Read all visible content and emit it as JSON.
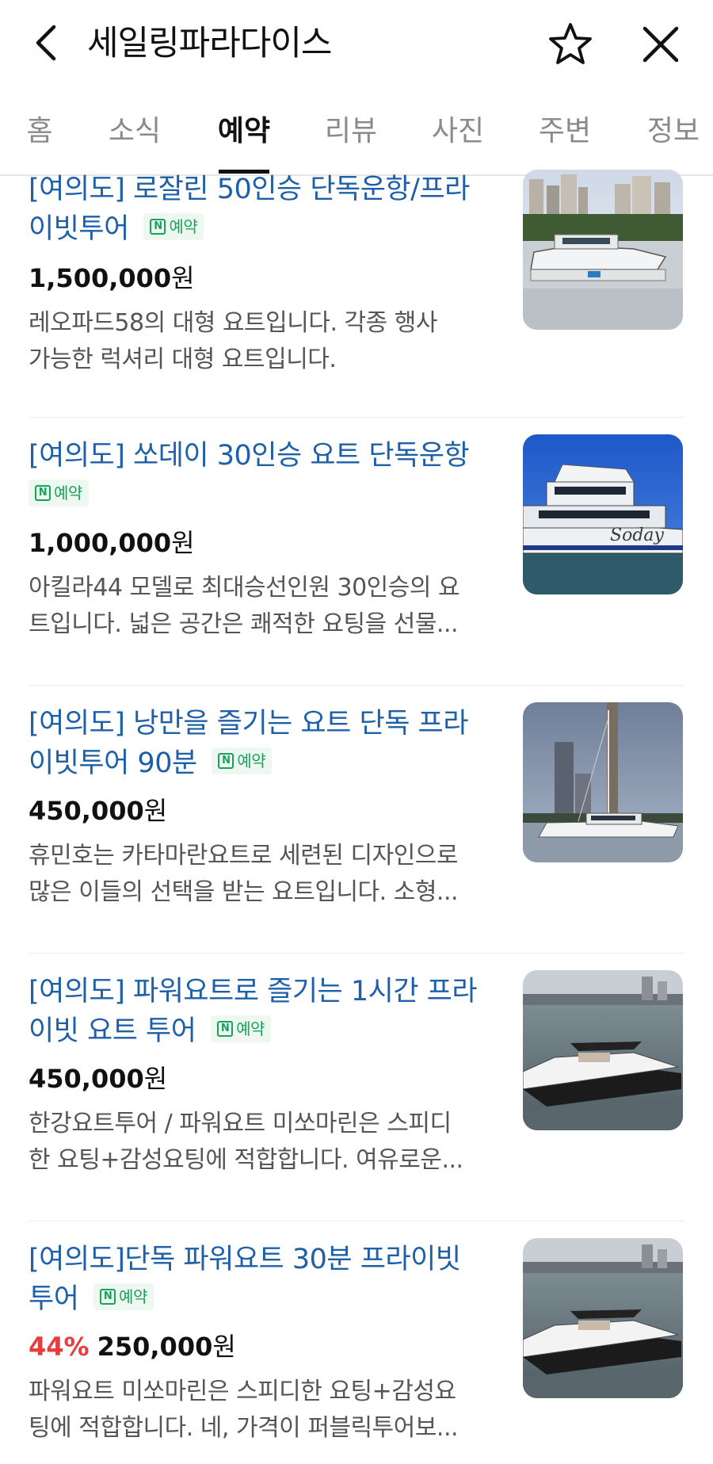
{
  "header": {
    "title": "세일링파라다이스",
    "back_icon": "chevron-left-icon",
    "star_icon": "star-outline-icon",
    "close_icon": "close-icon"
  },
  "tabs": [
    {
      "label": "홈"
    },
    {
      "label": "소식"
    },
    {
      "label": "예약",
      "active": true
    },
    {
      "label": "리뷰"
    },
    {
      "label": "사진"
    },
    {
      "label": "주변"
    },
    {
      "label": "정보"
    }
  ],
  "badge_label": "예약",
  "badge_icon": "naver-n-icon",
  "colors": {
    "link_blue": "#1d5fa8",
    "badge_green": "#15a45c",
    "discount_red": "#e53e3e"
  },
  "items": [
    {
      "title_lines": [
        "[여의도] 로잘린 50인승 단독운항/프라",
        "이빗투어"
      ],
      "price": "1,500,000",
      "won": "원",
      "desc_lines": [
        "레오파드58의 대형 요트입니다. 각종 행사",
        "가능한 럭셔리 대형 요트입니다."
      ],
      "thumb": "yacht-catamaran-river-photo"
    },
    {
      "title_lines": [
        "[여의도] 쏘데이 30인승 요트 단독운항"
      ],
      "price": "1,000,000",
      "won": "원",
      "desc_lines": [
        "아킬라44 모델로 최대승선인원 30인승의 요",
        "트입니다. 넓은 공간은 쾌적한 요팅을 선물..."
      ],
      "thumb": "soday-yacht-photo"
    },
    {
      "title_lines": [
        "[여의도] 낭만을 즐기는 요트 단독 프라",
        "이빗투어 90분"
      ],
      "price": "450,000",
      "won": "원",
      "desc_lines": [
        "휴민호는 카타마란요트로 세련된 디자인으로",
        "많은 이들의 선택을 받는 요트입니다. 소형..."
      ],
      "thumb": "sailing-catamaran-photo"
    },
    {
      "title_lines": [
        "[여의도] 파워요트로 즐기는 1시간 프라",
        "이빗 요트 투어"
      ],
      "price": "450,000",
      "won": "원",
      "desc_lines": [
        "한강요트투어 / 파워요트 미쏘마린은 스피디",
        "한 요팅+감성요팅에 적합합니다. 여유로운..."
      ],
      "thumb": "power-yacht-bridge-photo"
    },
    {
      "title_lines": [
        "[여의도]단독 파워요트 30분 프라이빗",
        "투어"
      ],
      "discount": "44%",
      "price": "250,000",
      "won": "원",
      "desc_lines": [
        "파워요트 미쏘마린은 스피디한 요팅+감성요",
        "팅에 적합합니다. 네, 가격이 퍼블릭투어보..."
      ],
      "thumb": "power-yacht-bridge-photo"
    }
  ]
}
